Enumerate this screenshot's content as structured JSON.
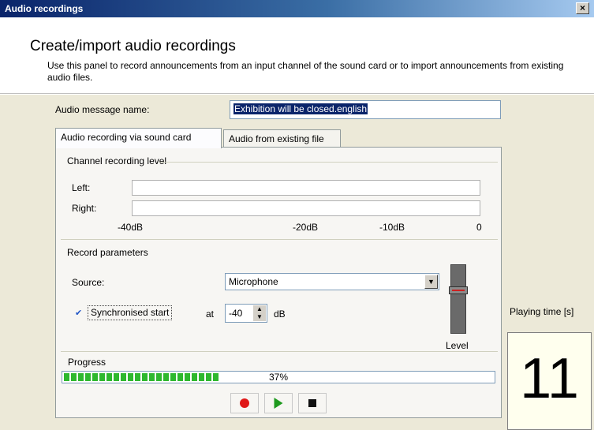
{
  "window": {
    "title": "Audio recordings",
    "close_label": "×"
  },
  "header": {
    "title": "Create/import audio recordings",
    "description": "Use this panel to record announcements from an input channel of the sound card or to import announcements from existing audio files."
  },
  "message": {
    "label": "Audio message name:",
    "value": "Exhibition will be closed.english"
  },
  "tabs": [
    {
      "label": "Audio recording via sound card",
      "active": true
    },
    {
      "label": "Audio from existing file",
      "active": false
    }
  ],
  "channel_level": {
    "title": "Channel recording level",
    "left_label": "Left:",
    "right_label": "Right:",
    "scale": [
      "-40dB",
      "-20dB",
      "-10dB",
      "0"
    ]
  },
  "record_params": {
    "title": "Record parameters",
    "source_label": "Source:",
    "source_value": "Microphone",
    "sync_checked": true,
    "sync_label": "Synchronised start",
    "at_label": "at",
    "threshold_value": "-40",
    "db_unit": "dB",
    "level_label": "Level"
  },
  "progress": {
    "title": "Progress",
    "percent": 37,
    "text": "37%"
  },
  "playing_time": {
    "label": "Playing time [s]",
    "value": "11"
  },
  "colors": {
    "progress_green": "#2eb82e",
    "record_red": "#e01818",
    "play_green": "#1f9a1f",
    "title_blue": "#0a246a"
  }
}
